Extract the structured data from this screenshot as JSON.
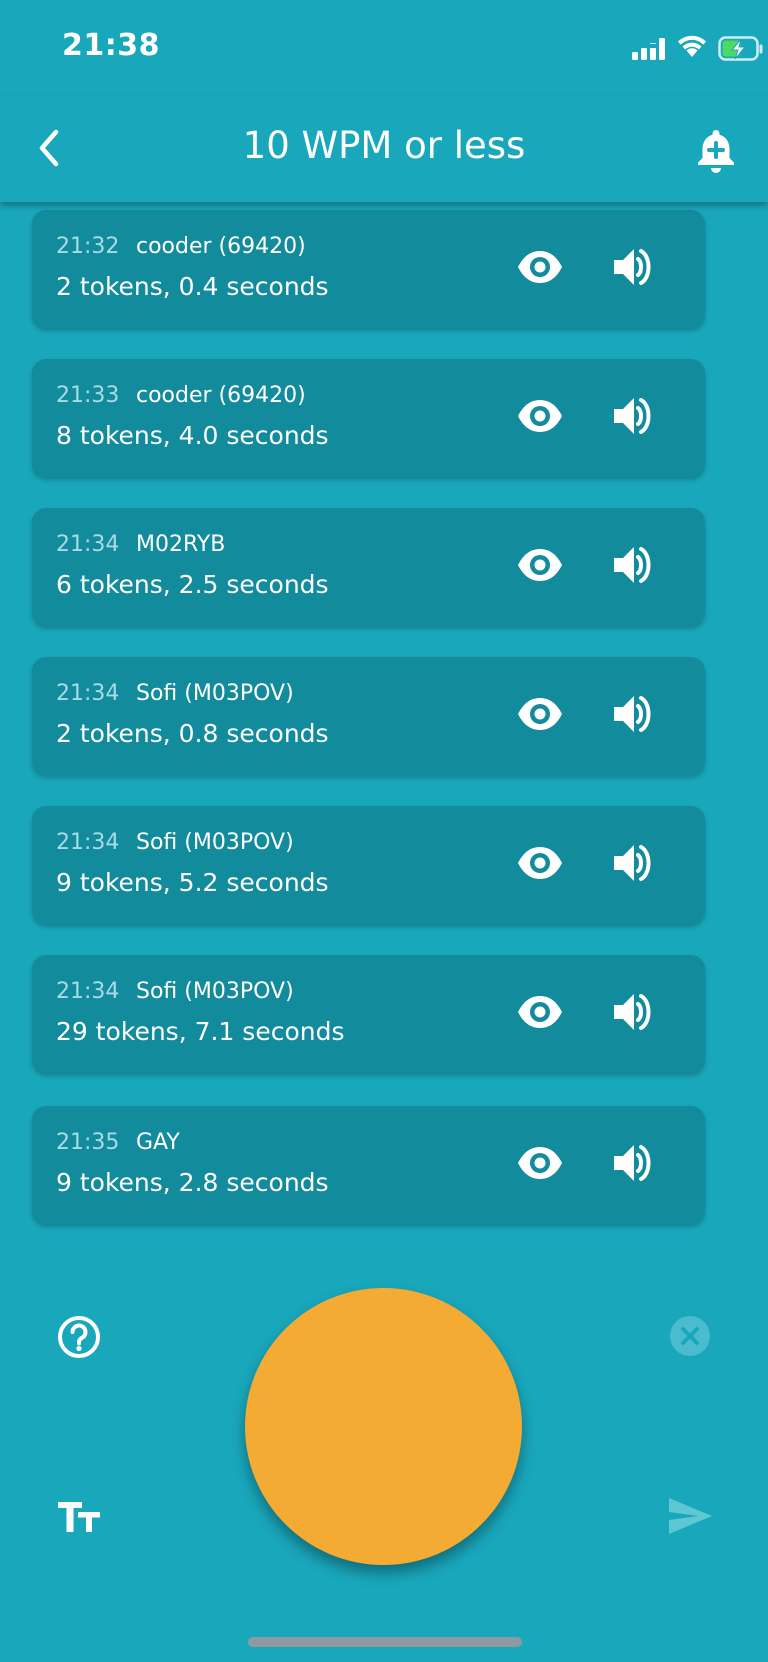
{
  "status_bar": {
    "time": "21:38",
    "icons": [
      "signal-icon",
      "wifi-icon",
      "battery-charging-icon"
    ],
    "battery_color": "#4cd964"
  },
  "app_bar": {
    "title": "10 WPM or less",
    "back_icon": "chevron-left-icon",
    "action_icon": "bell-plus-icon"
  },
  "messages": [
    {
      "time": "21:32",
      "sender": "cooder (69420)",
      "summary": "2 tokens, 0.4 seconds"
    },
    {
      "time": "21:33",
      "sender": "cooder (69420)",
      "summary": "8 tokens, 4.0 seconds"
    },
    {
      "time": "21:34",
      "sender": "M02RYB",
      "summary": "6 tokens, 2.5 seconds"
    },
    {
      "time": "21:34",
      "sender": "Sofi (M03POV)",
      "summary": "2 tokens, 0.8 seconds"
    },
    {
      "time": "21:34",
      "sender": "Sofi (M03POV)",
      "summary": "9 tokens, 5.2 seconds"
    },
    {
      "time": "21:34",
      "sender": "Sofi (M03POV)",
      "summary": "29 tokens, 7.1 seconds"
    },
    {
      "time": "21:35",
      "sender": "GAY",
      "summary": "9 tokens, 2.8 seconds"
    }
  ],
  "card_icons": [
    "eye-icon",
    "speaker-icon"
  ],
  "controls": {
    "help_icon": "help-circle-icon",
    "clear_icon": "close-circle-icon",
    "text_size_icon": "text-size-icon",
    "send_icon": "send-icon",
    "key_color": "#f4ab33"
  },
  "colors": {
    "background": "#19a7bc",
    "card": "#128b9d",
    "time_text": "#a9dbe3"
  }
}
